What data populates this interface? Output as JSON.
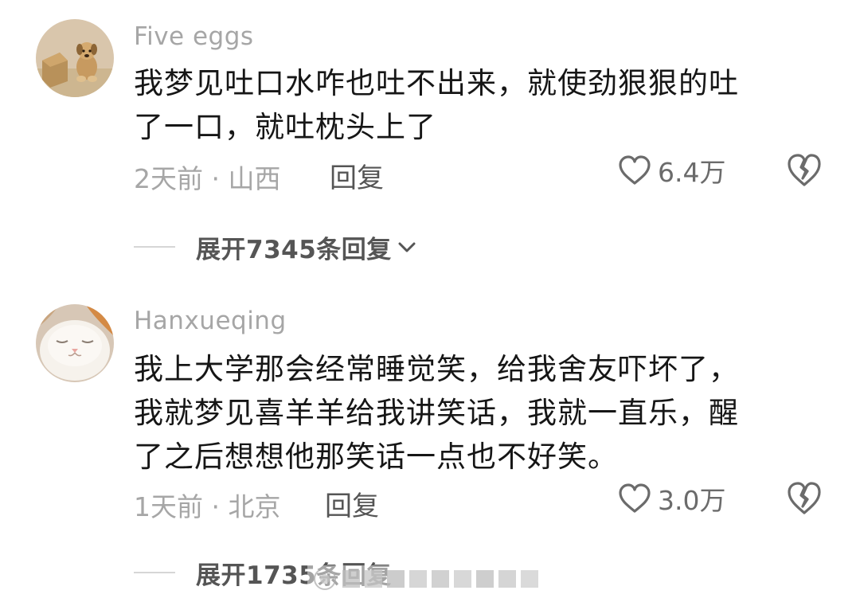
{
  "comments": [
    {
      "username": "Five eggs",
      "text_lines": [
        "我梦见吐口水咋也吐不出来，就使劲狠狠的吐",
        "了一口，就吐枕头上了"
      ],
      "time_location": "2天前 · 山西",
      "reply_label": "回复",
      "likes": "6.4万",
      "expand_label": "展开7345条回复"
    },
    {
      "username": "Hanxueqing",
      "text_lines": [
        "我上大学那会经常睡觉笑，给我舍友吓坏了，",
        "我就梦见喜羊羊给我讲笑话，我就一直乐，醒",
        "了之后想想他那笑话一点也不好笑。"
      ],
      "time_location": "1天前 · 北京",
      "reply_label": "回复",
      "likes": "3.0万",
      "expand_label": "展开1735条回复"
    }
  ],
  "icons": {
    "like": "heart-outline-icon",
    "dislike": "broken-heart-icon",
    "expand": "chevron-down-icon"
  },
  "colors": {
    "meta_gray": "#a6a6a6",
    "text": "#161616",
    "action_gray": "#555555"
  }
}
